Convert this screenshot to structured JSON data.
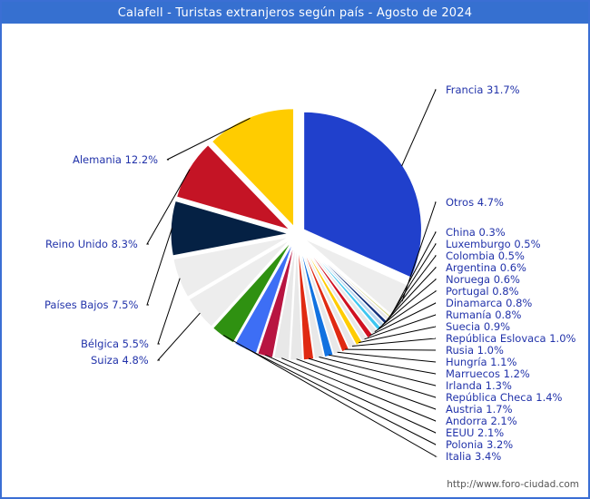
{
  "window": {
    "title": "Calafell - Turistas extranjeros según país - Agosto de 2024"
  },
  "footer": {
    "url": "http://www.foro-ciudad.com"
  },
  "colors": {
    "title_bar": "#3670d0",
    "frame": "#3b6fd4",
    "label_text": "#2233aa",
    "leader_line": "#000000",
    "background": "#ffffff"
  },
  "chart_data": {
    "type": "pie",
    "title": "Calafell - Turistas extranjeros según país - Agosto de 2024",
    "unit": "%",
    "legend": "none",
    "labels_inline": true,
    "categories": [
      "Francia",
      "Alemania",
      "Reino Unido",
      "Países Bajos",
      "Bélgica",
      "Suiza",
      "Italia",
      "Polonia",
      "EEUU",
      "Andorra",
      "Austria",
      "República Checa",
      "Irlanda",
      "Marruecos",
      "Hungría",
      "Rusia",
      "República Eslovaca",
      "Suecia",
      "Rumanía",
      "Dinamarca",
      "Portugal",
      "Noruega",
      "Argentina",
      "Colombia",
      "Luxemburgo",
      "China",
      "Otros"
    ],
    "values": [
      31.7,
      12.2,
      8.3,
      7.5,
      5.5,
      4.8,
      3.4,
      3.2,
      2.1,
      2.1,
      1.7,
      1.4,
      1.3,
      1.2,
      1.1,
      1.0,
      1.0,
      0.9,
      0.8,
      0.8,
      0.8,
      0.6,
      0.6,
      0.5,
      0.5,
      0.3,
      4.7
    ],
    "slices": [
      {
        "label": "Francia 31.7%",
        "name": "Francia",
        "value": 31.7,
        "color": "#2040cc"
      },
      {
        "label": "Otros 4.7%",
        "name": "Otros",
        "value": 4.7,
        "color": "#ededed"
      },
      {
        "label": "China 0.3%",
        "name": "China",
        "value": 0.3,
        "color": "#d8d88a"
      },
      {
        "label": "Luxemburgo 0.5%",
        "name": "Luxemburgo",
        "value": 0.5,
        "color": "#e8e8e8"
      },
      {
        "label": "Colombia 0.5%",
        "name": "Colombia",
        "value": 0.5,
        "color": "#12307a"
      },
      {
        "label": "Argentina 0.6%",
        "name": "Argentina",
        "value": 0.6,
        "color": "#bcd8f0"
      },
      {
        "label": "Noruega 0.6%",
        "name": "Noruega",
        "value": 0.6,
        "color": "#3ec6f0"
      },
      {
        "label": "Portugal 0.8%",
        "name": "Portugal",
        "value": 0.8,
        "color": "#e8e8e8"
      },
      {
        "label": "Dinamarca 0.8%",
        "name": "Dinamarca",
        "value": 0.8,
        "color": "#d01020"
      },
      {
        "label": "Rumanía 0.8%",
        "name": "Rumanía",
        "value": 0.8,
        "color": "#e8e8e8"
      },
      {
        "label": "Suecia 0.9%",
        "name": "Suecia",
        "value": 0.9,
        "color": "#ffcc00"
      },
      {
        "label": "República Eslovaca 1.0%",
        "name": "República Eslovaca",
        "value": 1.0,
        "color": "#e8e8e8"
      },
      {
        "label": "Rusia 1.0%",
        "name": "Rusia",
        "value": 1.0,
        "color": "#e02a12"
      },
      {
        "label": "Hungría 1.1%",
        "name": "Hungría",
        "value": 1.1,
        "color": "#e8e8e8"
      },
      {
        "label": "Marruecos 1.2%",
        "name": "Marruecos",
        "value": 1.2,
        "color": "#1272e0"
      },
      {
        "label": "Irlanda 1.3%",
        "name": "Irlanda",
        "value": 1.3,
        "color": "#e8e8e8"
      },
      {
        "label": "República Checa 1.4%",
        "name": "República Checa",
        "value": 1.4,
        "color": "#e02a12"
      },
      {
        "label": "Austria 1.7%",
        "name": "Austria",
        "value": 1.7,
        "color": "#e8e8e8"
      },
      {
        "label": "Andorra 2.1%",
        "name": "Andorra",
        "value": 2.1,
        "color": "#e8e8e8"
      },
      {
        "label": "EEUU 2.1%",
        "name": "EEUU",
        "value": 2.1,
        "color": "#b81541"
      },
      {
        "label": "Polonia 3.2%",
        "name": "Polonia",
        "value": 3.2,
        "color": "#3d6ef5"
      },
      {
        "label": "Italia 3.4%",
        "name": "Italia",
        "value": 3.4,
        "color": "#2f9111"
      },
      {
        "label": "Suiza 4.8%",
        "name": "Suiza",
        "value": 4.8,
        "color": "#ededed"
      },
      {
        "label": "Bélgica 5.5%",
        "name": "Bélgica",
        "value": 5.5,
        "color": "#ededed"
      },
      {
        "label": "Países Bajos 7.5%",
        "name": "Países Bajos",
        "value": 7.5,
        "color": "#052144"
      },
      {
        "label": "Reino Unido 8.3%",
        "name": "Reino Unido",
        "value": 8.3,
        "color": "#c41425"
      },
      {
        "label": "Alemania 12.2%",
        "name": "Alemania",
        "value": 12.2,
        "color": "#ffcc00"
      }
    ]
  }
}
